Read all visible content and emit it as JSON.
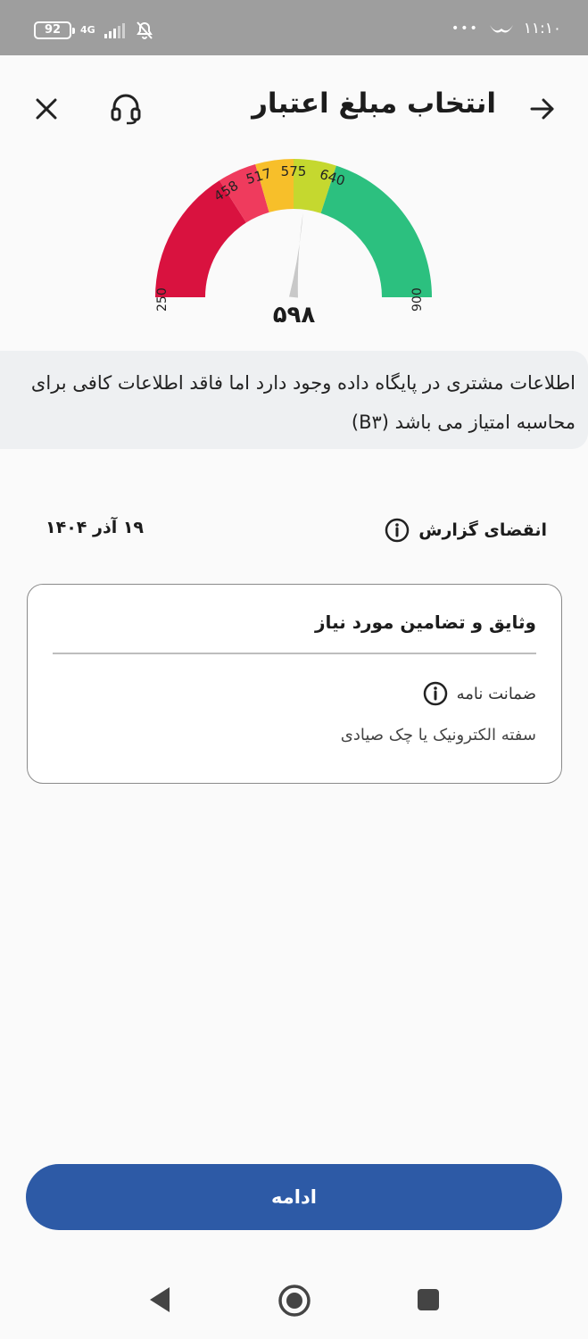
{
  "status_bar": {
    "battery": "92",
    "network": "4G",
    "time": "۱۱:۱۰",
    "dots": "•••"
  },
  "header": {
    "title": "انتخاب مبلغ اعتبار"
  },
  "gauge": {
    "min_label": "250",
    "max_label": "900",
    "tick_labels": [
      "458",
      "517",
      "575",
      "640"
    ],
    "score": "۵۹۸",
    "score_value": 598,
    "min": 250,
    "max": 900,
    "segments": [
      {
        "from": 250,
        "to": 458,
        "color": "#d9123f"
      },
      {
        "from": 458,
        "to": 517,
        "color": "#ef3b5d"
      },
      {
        "from": 517,
        "to": 575,
        "color": "#f7bf2a"
      },
      {
        "from": 575,
        "to": 640,
        "color": "#c5d82f"
      },
      {
        "from": 640,
        "to": 900,
        "color": "#2cc07f"
      }
    ]
  },
  "notice": {
    "text": "اطلاعات مشتری در پایگاه داده وجود دارد اما فاقد اطلاعات کافی برای محاسبه امتیاز می باشد (B۳)"
  },
  "report": {
    "expiry_label": "انقضای گزارش",
    "expiry_date": "۱۹ آذر ۱۴۰۴"
  },
  "guarantees": {
    "title": "وثایق و تضامین مورد نیاز",
    "item_label": "ضمانت نامه",
    "item_value": "سفته الکترونیک یا چک صیادی"
  },
  "actions": {
    "continue_label": "ادامه"
  },
  "colors": {
    "primary": "#2d5aa6",
    "status_bar": "#9e9e9e",
    "notice_bg": "#eef0f2"
  }
}
